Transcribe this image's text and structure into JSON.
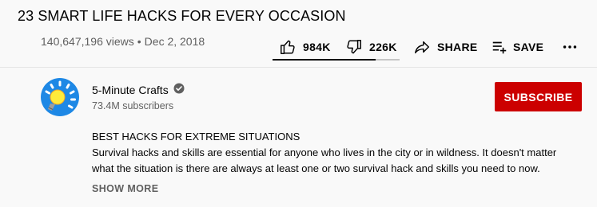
{
  "video": {
    "title": "23 SMART LIFE HACKS FOR EVERY OCCASION",
    "views": "140,647,196 views",
    "separator": "•",
    "date": "Dec 2, 2018"
  },
  "actions": {
    "like_count": "984K",
    "dislike_count": "226K",
    "share_label": "SHARE",
    "save_label": "SAVE",
    "more_icon": "more-horizontal-icon",
    "like_ratio": 0.81
  },
  "channel": {
    "name": "5-Minute Crafts",
    "verified_icon": "verified-check-icon",
    "subscribers": "73.4M subscribers",
    "subscribe_label": "SUBSCRIBE",
    "subscribe_color": "#cc0000",
    "avatar_icon": "lightbulb-logo-icon",
    "avatar_color": "#1e88e5"
  },
  "description": {
    "heading": "BEST HACKS FOR EXTREME SITUATIONS",
    "body": "Survival hacks and skills are essential for anyone who lives in the city or in wildness. It doesn't matter what the situation is there are always at least one or two survival hack and skills you need to now.",
    "show_more": "SHOW MORE"
  }
}
